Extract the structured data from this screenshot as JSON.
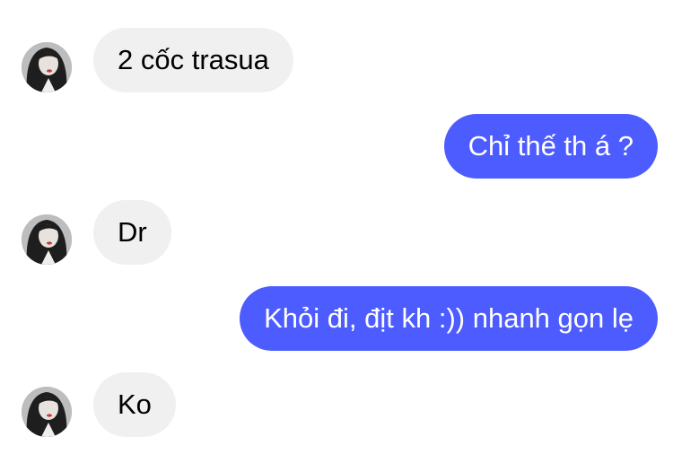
{
  "conversation": {
    "messages": [
      {
        "sender": "them",
        "text": "2 cốc trasua"
      },
      {
        "sender": "me",
        "text": "Chỉ thế th á ?"
      },
      {
        "sender": "them",
        "text": "Dr"
      },
      {
        "sender": "me",
        "text": "Khỏi đi, địt kh :)) nhanh gọn lẹ"
      },
      {
        "sender": "them",
        "text": "Ko"
      }
    ],
    "colors": {
      "incoming_bubble": "#f0f0f0",
      "outgoing_bubble": "#4d5cff",
      "incoming_text": "#000000",
      "outgoing_text": "#ffffff"
    },
    "contact_avatar_icon": "contact-avatar-photo"
  }
}
